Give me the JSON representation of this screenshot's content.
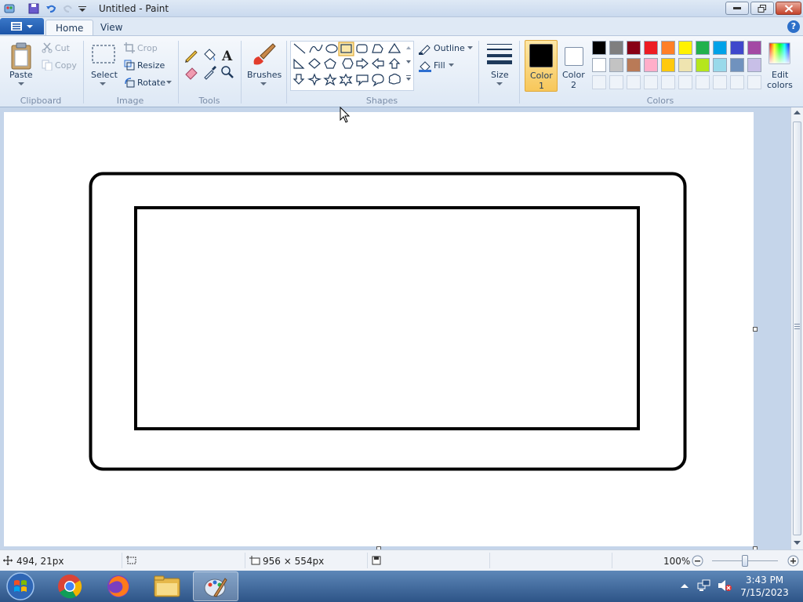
{
  "window": {
    "title": "Untitled - Paint"
  },
  "tabs": [
    {
      "label": "Home"
    },
    {
      "label": "View"
    }
  ],
  "clipboard": {
    "paste": "Paste",
    "cut": "Cut",
    "copy": "Copy",
    "group": "Clipboard"
  },
  "image": {
    "select": "Select",
    "crop": "Crop",
    "resize": "Resize",
    "rotate": "Rotate",
    "group": "Image"
  },
  "tools": {
    "group": "Tools"
  },
  "brushes": {
    "label": "Brushes"
  },
  "shapes": {
    "outline": "Outline",
    "fill": "Fill",
    "group": "Shapes"
  },
  "size": {
    "label": "Size"
  },
  "colors": {
    "color1_line1": "Color",
    "color1_line2": "1",
    "color2_line1": "Color",
    "color2_line2": "2",
    "edit_line1": "Edit",
    "edit_line2": "colors",
    "group": "Colors",
    "color1_value": "#000000",
    "color2_value": "#ffffff",
    "palette_row1": [
      "#000000",
      "#7f7f7f",
      "#880015",
      "#ed1c24",
      "#ff7f27",
      "#fff200",
      "#22b14c",
      "#00a2e8",
      "#3f48cc",
      "#a349a4"
    ],
    "palette_row2": [
      "#ffffff",
      "#c3c3c3",
      "#b97a57",
      "#ffaec9",
      "#ffc90e",
      "#efe4b0",
      "#b5e61d",
      "#99d9ea",
      "#7092be",
      "#c8bfe7"
    ]
  },
  "status": {
    "cursor_pos": "494, 21px",
    "canvas_size": "956 × 554px",
    "zoom": "100%"
  },
  "taskbar": {
    "time": "3:43 PM",
    "date": "7/15/2023"
  }
}
